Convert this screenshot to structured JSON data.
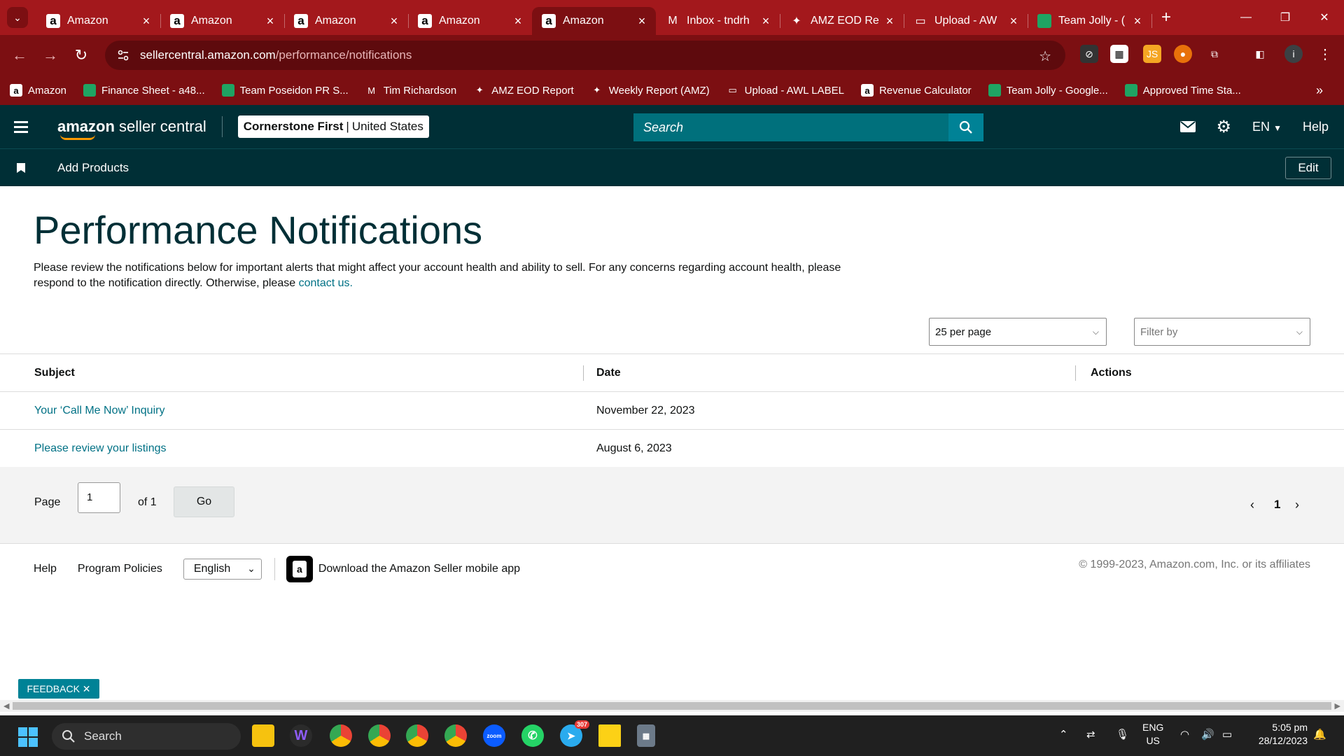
{
  "browser": {
    "tabs": [
      {
        "title": "Amazon",
        "icon": "amazon-icon"
      },
      {
        "title": "Amazon",
        "icon": "amazon-icon"
      },
      {
        "title": "Amazon",
        "icon": "amazon-icon"
      },
      {
        "title": "Amazon",
        "icon": "amazon-icon"
      },
      {
        "title": "Amazon",
        "icon": "amazon-icon",
        "active": true
      },
      {
        "title": "Inbox - tndrh",
        "icon": "gmail-icon"
      },
      {
        "title": "AMZ EOD Re",
        "icon": "apps-script-icon"
      },
      {
        "title": "Upload - AW",
        "icon": "upload-icon"
      },
      {
        "title": "Team Jolly - (",
        "icon": "sheets-icon"
      }
    ],
    "url_host": "sellercentral.amazon.com",
    "url_path": "/performance/notifications",
    "bookmarks": [
      {
        "label": "Amazon",
        "icon": "amazon-icon"
      },
      {
        "label": "Finance Sheet - a48...",
        "icon": "sheets-icon"
      },
      {
        "label": "Team Poseidon PR S...",
        "icon": "sheets-icon"
      },
      {
        "label": "Tim Richardson",
        "icon": "gmail-icon"
      },
      {
        "label": "AMZ EOD Report",
        "icon": "apps-script-icon"
      },
      {
        "label": "Weekly Report (AMZ)",
        "icon": "apps-script-icon"
      },
      {
        "label": "Upload - AWL LABEL",
        "icon": "upload-icon"
      },
      {
        "label": "Revenue Calculator",
        "icon": "amazon-icon"
      },
      {
        "label": "Team Jolly - Google...",
        "icon": "sheets-icon"
      },
      {
        "label": "Approved Time Sta...",
        "icon": "sheets-icon"
      }
    ]
  },
  "header": {
    "brand_bold": "amazon",
    "brand_rest": " seller central",
    "store_name": "Cornerstone First",
    "store_divider": "|",
    "store_region": "United States",
    "search_placeholder": "Search",
    "lang": "EN",
    "help": "Help",
    "subnav_item": "Add Products",
    "edit": "Edit"
  },
  "main": {
    "title": "Performance Notifications",
    "description": "Please review the notifications below for important alerts that might affect your account health and ability to sell. For any concerns regarding account health, please respond to the notification directly. Otherwise, please ",
    "contact_link": "contact us.",
    "per_page": "25 per page",
    "filter_placeholder": "Filter by",
    "columns": [
      "Subject",
      "Date",
      "Actions"
    ],
    "rows": [
      {
        "subject": "Your ‘Call Me Now’ Inquiry",
        "date": "November 22, 2023",
        "actions": ""
      },
      {
        "subject": "Please review your listings",
        "date": "August 6, 2023",
        "actions": ""
      }
    ],
    "pager": {
      "page_label": "Page",
      "page_value": "1",
      "of_label": "of 1",
      "go": "Go",
      "current": "1"
    }
  },
  "footer": {
    "help": "Help",
    "policies": "Program Policies",
    "language": "English",
    "app_text": "Download the Amazon Seller mobile app",
    "copyright": "© 1999-2023, Amazon.com, Inc. or its affiliates"
  },
  "feedback": "FEEDBACK ✕",
  "taskbar": {
    "search": "Search",
    "lang_top": "ENG",
    "lang_bottom": "US",
    "time": "5:05 pm",
    "date": "28/12/2023",
    "telegram_badge": "307"
  },
  "colors": {
    "chrome": "#a3181c",
    "amazon_header": "#002f36",
    "link": "#007185",
    "accent": "#008296"
  }
}
